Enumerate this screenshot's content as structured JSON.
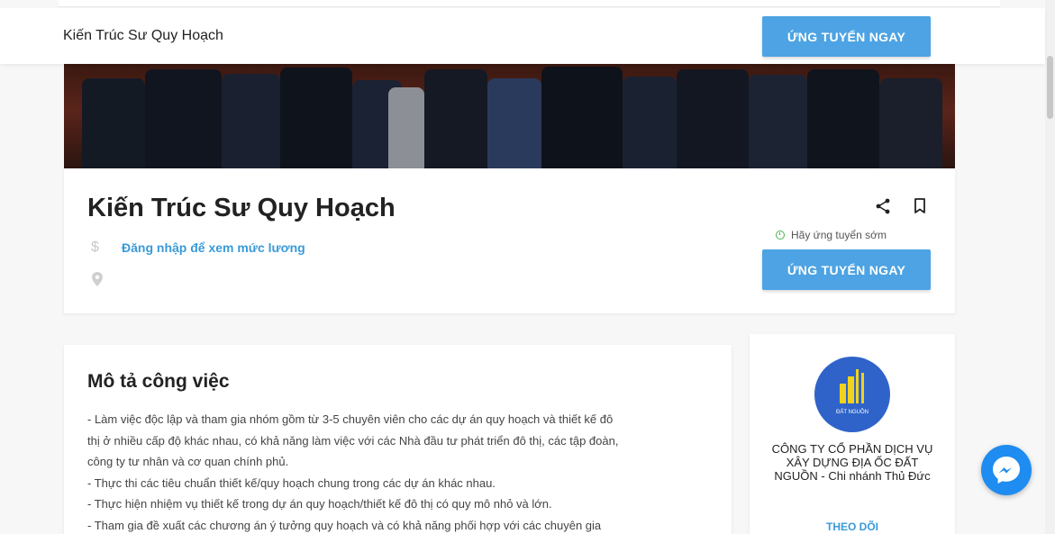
{
  "sticky_header": {
    "title": "Kiến Trúc Sư Quy Hoạch",
    "apply_label": "ỨNG TUYỂN NGAY"
  },
  "job": {
    "title": "Kiến Trúc Sư Quy Hoạch",
    "salary_link": "Đăng nhập để xem mức lương",
    "apply_early": "Hãy ứng tuyển sớm",
    "apply_label": "ỨNG TUYỂN NGAY"
  },
  "description": {
    "heading": "Mô tả công việc",
    "lines": [
      "- Làm việc độc lập và tham gia nhóm gồm từ 3-5 chuyên viên cho các dự án quy hoạch và thiết kế đô",
      "thị ở nhiều cấp độ khác nhau, có khả năng làm việc với các Nhà đầu tư phát triển đô thị, các tập đoàn,",
      "công ty tư nhân và cơ quan chính phủ.",
      "- Thực thi các tiêu chuẩn thiết kế/quy hoạch chung trong các dự án khác nhau.",
      "- Thực hiện nhiệm vụ thiết kế trong dự án quy hoạch/thiết kế đô thị có quy mô nhỏ và lớn.",
      "- Tham gia đề xuất các chương án ý tưởng quy hoạch và có khả năng phối hợp với các chuyên gia"
    ]
  },
  "company": {
    "logo_text": "ĐẤT NGUỒN",
    "name": "CÔNG TY CỔ PHẦN DỊCH VỤ XÂY DỰNG ĐỊA ỐC ĐẤT NGUỒN - Chi nhánh Thủ Đức",
    "follow_label": "THEO DÕI"
  },
  "icons": {
    "salary": "dollar-icon",
    "location": "location-pin-icon",
    "share": "share-icon",
    "bookmark": "bookmark-icon",
    "clock": "clock-icon",
    "chat": "messenger-icon"
  },
  "colors": {
    "primary": "#4da3e3",
    "link": "#3a9ad9",
    "logo_bg": "#2f63c9",
    "messenger": "#1e8cf0",
    "status_green": "#4caf50"
  }
}
